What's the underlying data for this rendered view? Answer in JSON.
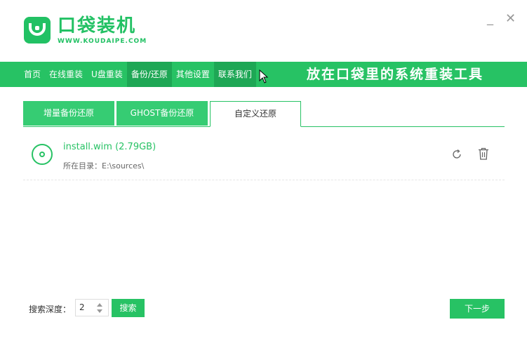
{
  "header": {
    "title": "口袋装机",
    "url": "WWW.KOUDAIPE.COM",
    "minimize": "_",
    "close": "✕"
  },
  "nav": {
    "items": [
      {
        "label": "首页"
      },
      {
        "label": "在线重装"
      },
      {
        "label": "U盘重装"
      },
      {
        "label": "备份/还原"
      },
      {
        "label": "其他设置"
      },
      {
        "label": "联系我们"
      }
    ],
    "active_index": 3,
    "slogan": "放在口袋里的系统重装工具"
  },
  "tabs": [
    {
      "label": "增量备份还原"
    },
    {
      "label": "GHOST备份还原"
    },
    {
      "label": "自定义还原"
    }
  ],
  "active_tab": 2,
  "file": {
    "name": "install.wim (2.79GB)",
    "path": "所在目录：E:\\sources\\",
    "icon": "disc-icon"
  },
  "footer": {
    "depth_label": "搜索深度：",
    "depth_value": "2",
    "search_label": "搜索",
    "next_label": "下一步"
  },
  "colors": {
    "brand_green": "#27c264",
    "nav_active": "#1ea755",
    "tab_inactive": "#36cc73"
  }
}
